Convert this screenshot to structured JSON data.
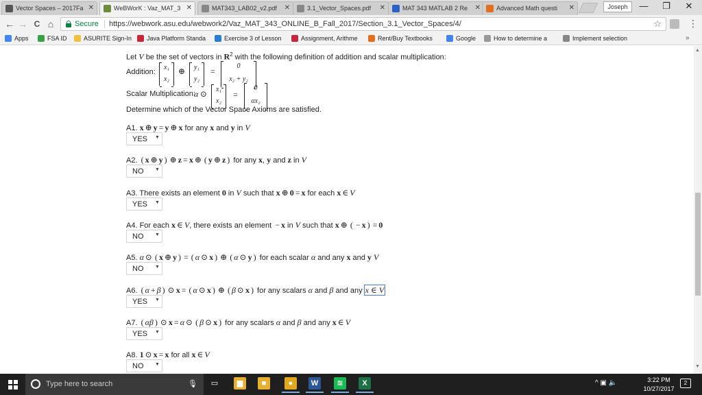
{
  "tabs": [
    {
      "title": "Vector Spaces – 2017Fa",
      "favicon": "note-icon",
      "color": "#555555",
      "active": false
    },
    {
      "title": "WeBWorK : Vaz_MAT_3",
      "favicon": "webwork-icon",
      "color": "#6a8f3a",
      "active": true
    },
    {
      "title": "MAT343_LAB02_v2.pdf",
      "favicon": "document-icon",
      "color": "#888888",
      "active": false
    },
    {
      "title": "3.1_Vector_Spaces.pdf",
      "favicon": "document-icon",
      "color": "#888888",
      "active": false
    },
    {
      "title": "MAT 343 MATLAB 2 Re",
      "favicon": "star-icon",
      "color": "#2a63c7",
      "active": false
    },
    {
      "title": "Advanced Math questi",
      "favicon": "chegg-icon",
      "color": "#e36f1e",
      "active": false
    }
  ],
  "profile_name": "Joseph",
  "window": {
    "minimize": "—",
    "restore": "❐",
    "close": "✕"
  },
  "nav": {
    "back": "←",
    "forward": "→",
    "reload": "C",
    "home": "⌂"
  },
  "address": {
    "secure_label": "Secure",
    "url": "https://webwork.asu.edu/webwork2/Vaz_MAT_343_ONLINE_B_Fall_2017/Section_3.1_Vector_Spaces/4/"
  },
  "bookmarks": [
    {
      "label": "Apps",
      "icon": "apps-grid-icon",
      "color": "#4285f4"
    },
    {
      "label": "FSA ID",
      "icon": "fsa-icon",
      "color": "#3aa34a"
    },
    {
      "label": "ASURITE Sign-In",
      "icon": "asu-icon",
      "color": "#f0c040"
    },
    {
      "label": "Java Platform Standa",
      "icon": "java-icon",
      "color": "#c8263a"
    },
    {
      "label": "Exercise 3 of Lesson",
      "icon": "ms-icon",
      "color": "#2b7cd3"
    },
    {
      "label": "Assignment, Arithme",
      "icon": "java-icon",
      "color": "#c8263a"
    },
    {
      "label": "Rent/Buy Textbooks",
      "icon": "chegg-icon",
      "color": "#e36f1e"
    },
    {
      "label": "Google",
      "icon": "google-icon",
      "color": "#4285f4"
    },
    {
      "label": "How to determine a",
      "icon": "quora-icon",
      "color": "#999999"
    },
    {
      "label": "Implement selection",
      "icon": "wiki-icon",
      "color": "#888888"
    }
  ],
  "bookmarks_more": "»",
  "problem": {
    "intro": [
      "Let ",
      "V",
      " be the set of vectors in ",
      "R",
      "2",
      " with the following definition of addition and scalar multiplication:"
    ],
    "addition_label": "Addition:",
    "addition": {
      "x": [
        "x₁",
        "x₂"
      ],
      "y": [
        "y₁",
        "y₂"
      ],
      "result": [
        "0",
        "x₂ + y₂"
      ],
      "plus": "⊕",
      "equals": "="
    },
    "scalar_label": "Scalar Multiplication:",
    "scalar": {
      "alpha": "α",
      "odot": "⊙",
      "x": [
        "x₁",
        "x₂"
      ],
      "result": [
        "0",
        "αx₂"
      ],
      "equals": "="
    },
    "instruction": "Determine which of the Vector Space Axioms are satisfied."
  },
  "axioms": [
    {
      "label": "A1.",
      "parts": [
        [
          "mb",
          "x"
        ],
        [
          "op",
          "⊕"
        ],
        [
          "mb",
          "y"
        ],
        [
          "op",
          "="
        ],
        [
          "mb",
          "y"
        ],
        [
          "op",
          "⊕"
        ],
        [
          "mb",
          "x"
        ],
        [
          "t",
          " for any "
        ],
        [
          "mb",
          "x"
        ],
        [
          "t",
          " and "
        ],
        [
          "mb",
          "y"
        ],
        [
          "t",
          " in "
        ],
        [
          "m",
          "V"
        ]
      ],
      "answer": "YES"
    },
    {
      "label": "A2.",
      "parts": [
        [
          "op",
          "("
        ],
        [
          "mb",
          "x"
        ],
        [
          "op",
          "⊕"
        ],
        [
          "mb",
          "y"
        ],
        [
          "op",
          ")"
        ],
        [
          "op",
          "⊕"
        ],
        [
          "mb",
          "z"
        ],
        [
          "op",
          "="
        ],
        [
          "mb",
          "x"
        ],
        [
          "op",
          "⊕"
        ],
        [
          "op",
          "("
        ],
        [
          "mb",
          "y"
        ],
        [
          "op",
          "⊕"
        ],
        [
          "mb",
          "z"
        ],
        [
          "op",
          ")"
        ],
        [
          "t",
          " for any "
        ],
        [
          "mb",
          "x"
        ],
        [
          "t",
          ", "
        ],
        [
          "mb",
          "y"
        ],
        [
          "t",
          " and "
        ],
        [
          "mb",
          "z"
        ],
        [
          "t",
          " in "
        ],
        [
          "m",
          "V"
        ]
      ],
      "answer": "NO"
    },
    {
      "label": "A3.",
      "parts": [
        [
          "t",
          "There exists an element "
        ],
        [
          "mb",
          "0"
        ],
        [
          "t",
          " in "
        ],
        [
          "m",
          "V"
        ],
        [
          "t",
          " such that "
        ],
        [
          "mb",
          "x"
        ],
        [
          "op",
          "⊕"
        ],
        [
          "mb",
          "0"
        ],
        [
          "op",
          "="
        ],
        [
          "mb",
          "x"
        ],
        [
          "t",
          " for each "
        ],
        [
          "mb",
          "x"
        ],
        [
          "op",
          "∈"
        ],
        [
          "m",
          "V"
        ]
      ],
      "answer": "YES"
    },
    {
      "label": "A4.",
      "parts": [
        [
          "t",
          "For each "
        ],
        [
          "mb",
          "x"
        ],
        [
          "op",
          "∈"
        ],
        [
          "m",
          "V"
        ],
        [
          "t",
          ", there exists an element "
        ],
        [
          "op",
          "−"
        ],
        [
          "mb",
          "x"
        ],
        [
          "t",
          " in "
        ],
        [
          "m",
          "V"
        ],
        [
          "t",
          " such that "
        ],
        [
          "mb",
          "x"
        ],
        [
          "op",
          "⊕"
        ],
        [
          "op",
          "("
        ],
        [
          "op",
          "−"
        ],
        [
          "mb",
          "x"
        ],
        [
          "op",
          ")"
        ],
        [
          "op",
          "="
        ],
        [
          "mb",
          "0"
        ]
      ],
      "answer": "NO"
    },
    {
      "label": "A5.",
      "parts": [
        [
          "m",
          "α"
        ],
        [
          "op",
          "⊙"
        ],
        [
          "op",
          "("
        ],
        [
          "mb",
          "x"
        ],
        [
          "op",
          "⊕"
        ],
        [
          "mb",
          "y"
        ],
        [
          "op",
          ")"
        ],
        [
          "op",
          "="
        ],
        [
          "op",
          "("
        ],
        [
          "m",
          "α"
        ],
        [
          "op",
          "⊙"
        ],
        [
          "mb",
          "x"
        ],
        [
          "op",
          ")"
        ],
        [
          "op",
          "⊕"
        ],
        [
          "op",
          "("
        ],
        [
          "m",
          "α"
        ],
        [
          "op",
          "⊙"
        ],
        [
          "mb",
          "y"
        ],
        [
          "op",
          ")"
        ],
        [
          "t",
          " for each scalar "
        ],
        [
          "m",
          "α"
        ],
        [
          "t",
          " and any "
        ],
        [
          "mb",
          "x"
        ],
        [
          "t",
          " and "
        ],
        [
          "mb",
          "y"
        ],
        [
          "t",
          " "
        ],
        [
          "m",
          "V"
        ]
      ],
      "answer": "NO"
    },
    {
      "label": "A6.",
      "parts": [
        [
          "op",
          "("
        ],
        [
          "m",
          "α"
        ],
        [
          "op",
          "+"
        ],
        [
          "m",
          "β"
        ],
        [
          "op",
          ")"
        ],
        [
          "op",
          "⊙"
        ],
        [
          "mb",
          "x"
        ],
        [
          "op",
          "="
        ],
        [
          "op",
          "("
        ],
        [
          "m",
          "α"
        ],
        [
          "op",
          "⊙"
        ],
        [
          "mb",
          "x"
        ],
        [
          "op",
          ")"
        ],
        [
          "op",
          "⊕"
        ],
        [
          "op",
          "("
        ],
        [
          "m",
          "β"
        ],
        [
          "op",
          "⊙"
        ],
        [
          "mb",
          "x"
        ],
        [
          "op",
          ")"
        ],
        [
          "t",
          " for any scalars "
        ],
        [
          "m",
          "α"
        ],
        [
          "t",
          " and "
        ],
        [
          "m",
          "β"
        ],
        [
          "t",
          " and any "
        ],
        [
          "hl",
          "x ∈ V"
        ]
      ],
      "answer": "YES"
    },
    {
      "label": "A7.",
      "parts": [
        [
          "op",
          "("
        ],
        [
          "m",
          "αβ"
        ],
        [
          "op",
          ")"
        ],
        [
          "op",
          "⊙"
        ],
        [
          "mb",
          "x"
        ],
        [
          "op",
          "="
        ],
        [
          "m",
          "α"
        ],
        [
          "op",
          "⊙"
        ],
        [
          "op",
          "("
        ],
        [
          "m",
          "β"
        ],
        [
          "op",
          "⊙"
        ],
        [
          "mb",
          "x"
        ],
        [
          "op",
          ")"
        ],
        [
          "t",
          " for any scalars "
        ],
        [
          "m",
          "α"
        ],
        [
          "t",
          " and "
        ],
        [
          "m",
          "β"
        ],
        [
          "t",
          " and any "
        ],
        [
          "mb",
          "x"
        ],
        [
          "op",
          "∈"
        ],
        [
          "m",
          "V"
        ]
      ],
      "answer": "YES"
    },
    {
      "label": "A8.",
      "parts": [
        [
          "mb",
          "1"
        ],
        [
          "op",
          "⊙"
        ],
        [
          "mb",
          "x"
        ],
        [
          "op",
          "="
        ],
        [
          "mb",
          "x"
        ],
        [
          "t",
          " for all "
        ],
        [
          "mb",
          "x"
        ],
        [
          "op",
          "∈"
        ],
        [
          "m",
          "V"
        ]
      ],
      "answer": "NO"
    }
  ],
  "taskbar": {
    "search_placeholder": "Type here to search",
    "apps": [
      {
        "name": "task-view-icon",
        "glyph": "▭",
        "color": "#1f1f1f"
      },
      {
        "name": "file-explorer-icon",
        "glyph": "▆",
        "color": "#e8b030"
      },
      {
        "name": "store-icon",
        "glyph": "■",
        "color": "#e8b030"
      },
      {
        "name": "chrome-icon",
        "glyph": "●",
        "color": "#e0a81a"
      },
      {
        "name": "word-icon",
        "glyph": "W",
        "color": "#2b5797"
      },
      {
        "name": "spotify-icon",
        "glyph": "≋",
        "color": "#1db954"
      },
      {
        "name": "excel-icon",
        "glyph": "X",
        "color": "#1e7145"
      }
    ],
    "tray": "^  ▣  🔈",
    "time": "3:22 PM",
    "date": "10/27/2017",
    "notifications": "2"
  }
}
